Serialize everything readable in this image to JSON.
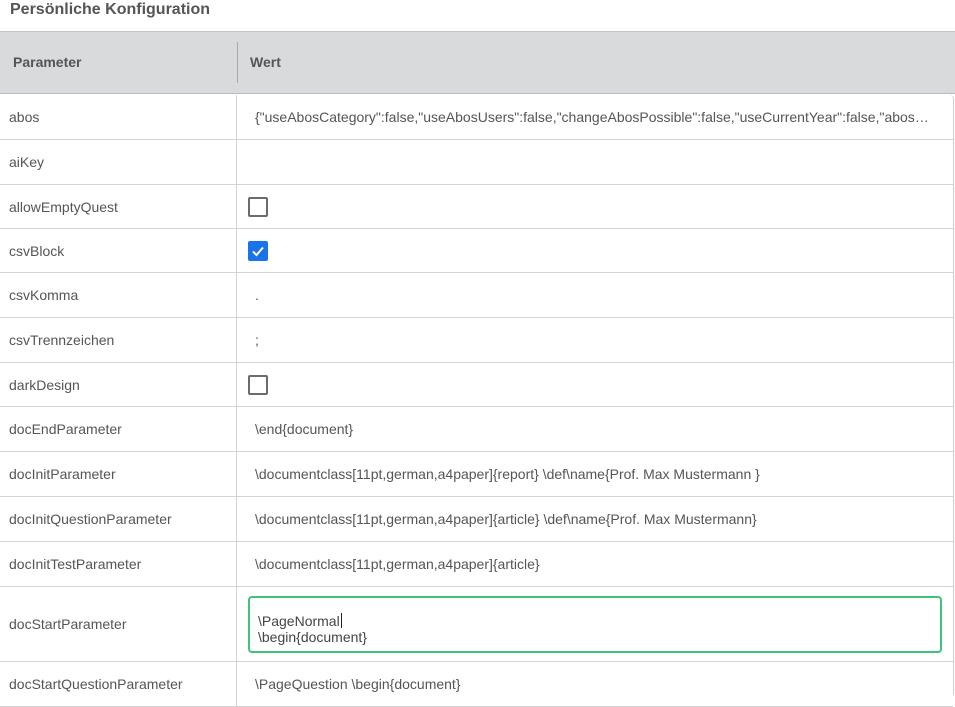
{
  "page": {
    "title": "Persönliche Konfiguration"
  },
  "table": {
    "headers": {
      "parameter": "Parameter",
      "value": "Wert"
    },
    "rows": [
      {
        "name": "abos",
        "value": "{\"useAbosCategory\":false,\"useAbosUsers\":false,\"changeAbosPossible\":false,\"useCurrentYear\":false,\"abosForNew\":false}"
      },
      {
        "name": "aiKey",
        "value": ""
      },
      {
        "name": "allowEmptyQuest",
        "checked": false
      },
      {
        "name": "csvBlock",
        "checked": true
      },
      {
        "name": "csvKomma",
        "value": "."
      },
      {
        "name": "csvTrennzeichen",
        "value": ";"
      },
      {
        "name": "darkDesign",
        "checked": false
      },
      {
        "name": "docEndParameter",
        "value": "\\end{document}"
      },
      {
        "name": "docInitParameter",
        "value": "\\documentclass[11pt,german,a4paper]{report} \\def\\name{Prof. Max Mustermann }"
      },
      {
        "name": "docInitQuestionParameter",
        "value": "\\documentclass[11pt,german,a4paper]{article} \\def\\name{Prof. Max Mustermann}"
      },
      {
        "name": "docInitTestParameter",
        "value": "\\documentclass[11pt,german,a4paper]{article}"
      },
      {
        "name": "docStartParameter",
        "value_lines": [
          "\\PageNormal",
          "\\begin{document}"
        ]
      },
      {
        "name": "docStartQuestionParameter",
        "value": "\\PageQuestion \\begin{document}"
      }
    ]
  },
  "colors": {
    "accent_check": "#1a73e8",
    "focus_border": "#3fc37a",
    "header_bg": "#d9dadb"
  },
  "icons": {
    "check": "checkmark-icon"
  }
}
